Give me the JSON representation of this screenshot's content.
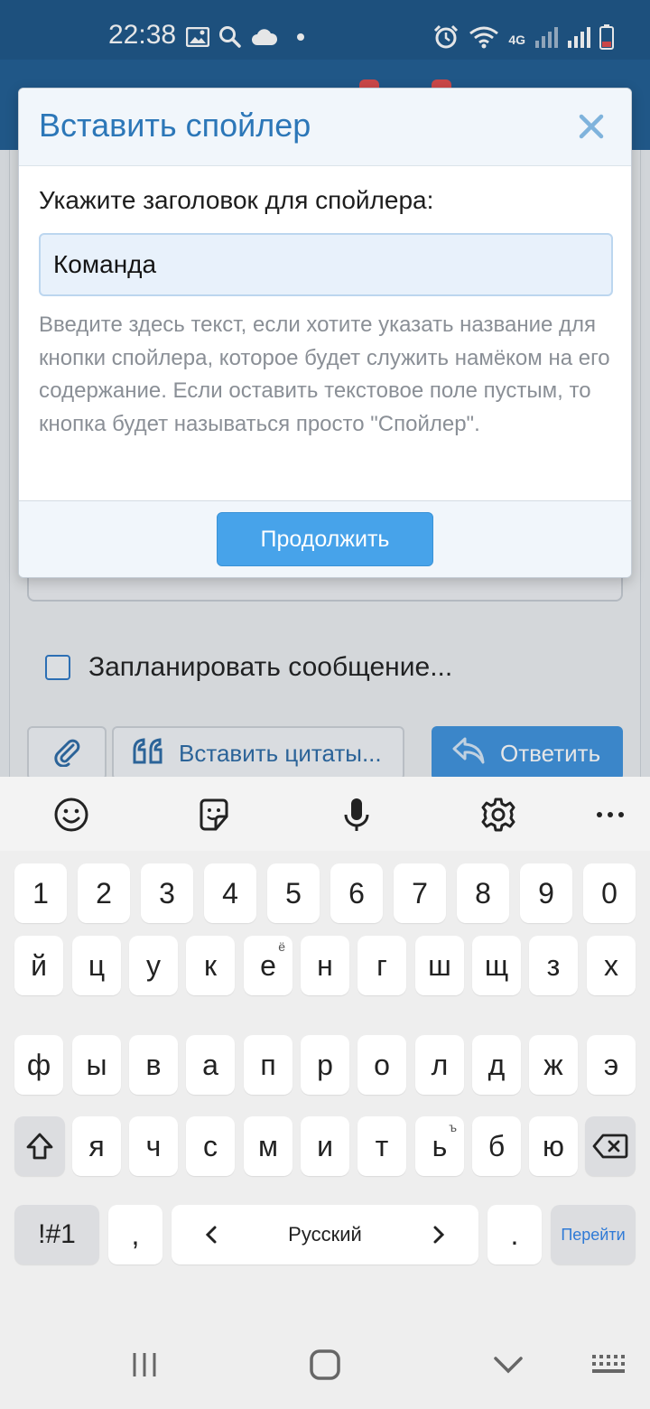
{
  "status_bar": {
    "time": "22:38",
    "network": "4G"
  },
  "schedule": {
    "label": "Запланировать сообщение..."
  },
  "toolbar": {
    "quote_label": "Вставить цитаты...",
    "reply_label": "Ответить"
  },
  "dialog": {
    "title": "Вставить спойлер",
    "field_label": "Укажите заголовок для спойлера:",
    "input_value": "Команда",
    "hint": "Введите здесь текст, если хотите указать название для кнопки спойлера, которое будет служить намёком на его содержание. Если оставить текстовое поле пустым, то кнопка будет называться просто \"Спойлер\".",
    "continue_label": "Продолжить"
  },
  "keyboard": {
    "number_row": [
      "1",
      "2",
      "3",
      "4",
      "5",
      "6",
      "7",
      "8",
      "9",
      "0"
    ],
    "row1": [
      "й",
      "ц",
      "у",
      "к",
      "е",
      "н",
      "г",
      "ш",
      "щ",
      "з",
      "х"
    ],
    "row1_sup": {
      "4": "ё"
    },
    "row2": [
      "ф",
      "ы",
      "в",
      "а",
      "п",
      "р",
      "о",
      "л",
      "д",
      "ж",
      "э"
    ],
    "row3": [
      "я",
      "ч",
      "с",
      "м",
      "и",
      "т",
      "ь",
      "б",
      "ю"
    ],
    "row3_sup": {
      "6": "ъ"
    },
    "symbols_label": "!#1",
    "comma_label": ",",
    "space_label": "Русский",
    "period_label": ".",
    "go_label": "Перейти"
  },
  "colors": {
    "status_bar": "#1c5587",
    "accent": "#2c77b8",
    "primary_button": "#47a3ea"
  }
}
